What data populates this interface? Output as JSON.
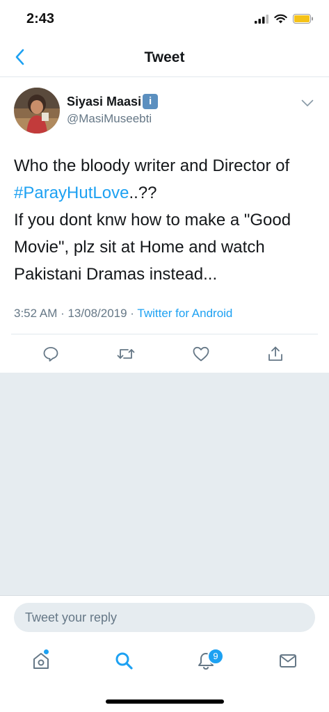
{
  "status_bar": {
    "time": "2:43"
  },
  "nav": {
    "title": "Tweet"
  },
  "tweet": {
    "author_name": "Siyasi Maasi",
    "info_badge": "i",
    "author_handle": "@MasiMuseebti",
    "text": {
      "line1": "Who the bloody writer and Director of",
      "hashtag": "#ParayHutLove",
      "after_hashtag": "..??",
      "line2": "If you dont knw how to make a \"Good Movie\", plz sit at Home and watch Pakistani Dramas instead..."
    },
    "timestamp": "3:52 AM · 13/08/2019 · ",
    "source": "Twitter for Android"
  },
  "reply": {
    "placeholder": "Tweet your reply"
  },
  "tabs": {
    "notifications_count": "9"
  },
  "colors": {
    "accent": "#1da1f2",
    "muted": "#657786",
    "background_grey": "#e6ecf0"
  },
  "icons": [
    "back-arrow-icon",
    "signal-icon",
    "wifi-icon",
    "battery-icon",
    "chevron-down-icon",
    "reply-icon",
    "retweet-icon",
    "like-icon",
    "share-icon",
    "home-icon",
    "search-icon",
    "notifications-icon",
    "messages-icon"
  ]
}
